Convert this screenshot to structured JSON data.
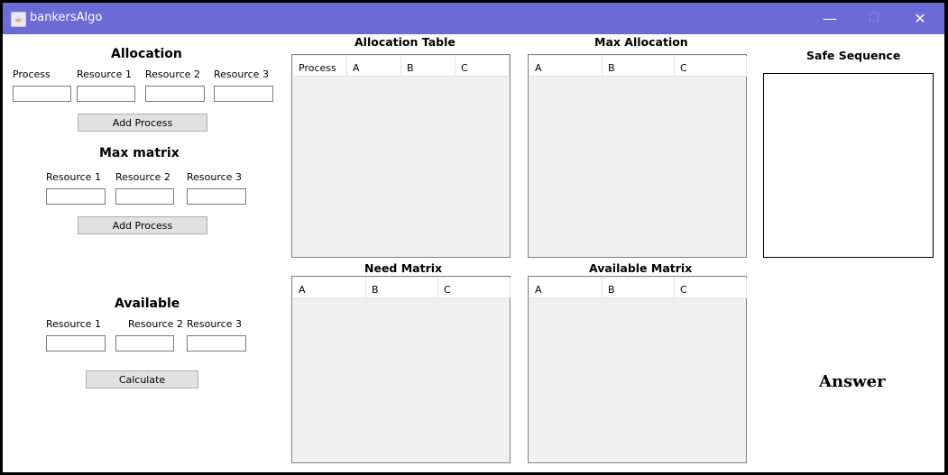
{
  "window": {
    "title": "bankersAlgo",
    "controls": {
      "minimize": "—",
      "maximize": "☐",
      "close": "✕"
    }
  },
  "allocation": {
    "heading": "Allocation",
    "labels": [
      "Process",
      "Resource 1",
      "Resource 2",
      "Resource 3"
    ],
    "values": [
      "",
      "",
      "",
      ""
    ],
    "button": "Add Process"
  },
  "max_matrix": {
    "heading": "Max matrix",
    "labels": [
      "Resource 1",
      "Resource 2",
      "Resource 3"
    ],
    "values": [
      "",
      "",
      ""
    ],
    "button": "Add Process"
  },
  "available": {
    "heading": "Available",
    "labels": [
      "Resource 1",
      "Resource 2",
      "Resource 3"
    ],
    "values": [
      "",
      "",
      ""
    ],
    "button": "Calculate"
  },
  "tables": {
    "allocation_table": {
      "title": "Allocation Table",
      "columns": [
        "Process",
        "A",
        "B",
        "C"
      ]
    },
    "max_allocation": {
      "title": "Max Allocation",
      "columns": [
        "A",
        "B",
        "C"
      ]
    },
    "need_matrix": {
      "title": "Need Matrix",
      "columns": [
        "A",
        "B",
        "C"
      ]
    },
    "available_matrix": {
      "title": "Available Matrix",
      "columns": [
        "A",
        "B",
        "C"
      ]
    }
  },
  "safe_sequence": {
    "title": "Safe Sequence",
    "content": ""
  },
  "answer": {
    "label": "Answer"
  }
}
